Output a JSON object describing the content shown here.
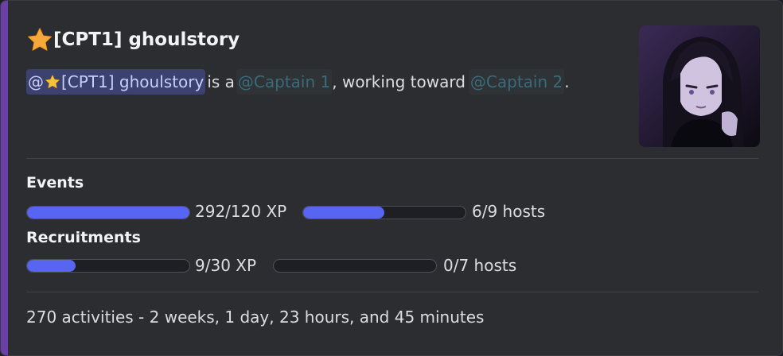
{
  "embed": {
    "accent_color": "#6b3fa8",
    "title_icon": "star-icon",
    "title": "[CPT1] ghoulstory",
    "description": {
      "user_mention": "@",
      "user_mention_name": "[CPT1] ghoulstory",
      "text_1": "is a",
      "role_mention_current": "@Captain 1",
      "text_2": ", working toward",
      "role_mention_next": "@Captain 2",
      "text_3": "."
    },
    "thumbnail": "avatar-portrait"
  },
  "events": {
    "label": "Events",
    "xp_text": "292/120 XP",
    "xp_progress": 1.0,
    "hosts_text": "6/9 hosts",
    "hosts_progress": 0.5
  },
  "recruitments": {
    "label": "Recruitments",
    "xp_text": "9/30 XP",
    "xp_progress": 0.3,
    "hosts_text": "0/7 hosts",
    "hosts_progress": 0.0
  },
  "footer": {
    "text": "270 activities - 2 weeks, 1 day, 23 hours, and 45 minutes"
  },
  "colors": {
    "background": "#2b2d31",
    "progress_fill": "#5865f2",
    "mention_user_bg": "#3c4270",
    "mention_user_fg": "#c9cdfb"
  }
}
